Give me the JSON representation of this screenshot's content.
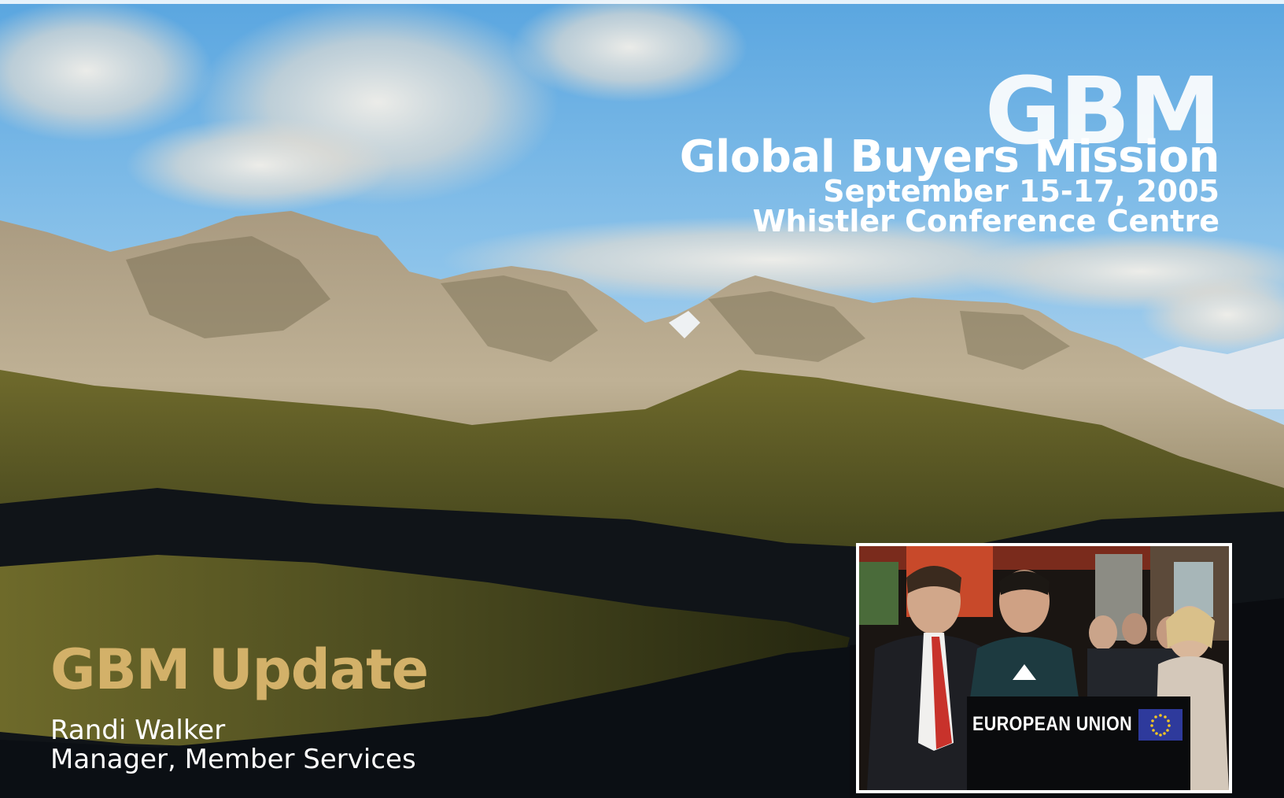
{
  "header": {
    "abbr": "GBM",
    "event_name": "Global Buyers Mission",
    "dates": "September 15-17, 2005",
    "venue": "Whistler Conference Centre"
  },
  "update": {
    "title": "GBM Update",
    "presenter_name": "Randi Walker",
    "presenter_role": "Manager, Member Services"
  },
  "photo": {
    "sign_text": "EUROPEAN UNION",
    "flag_icon": "eu-flag-icon"
  },
  "colors": {
    "accent_gold": "#d3b169",
    "title_white": "#ffffff",
    "sky": "#6fb2e6",
    "frame": "#ffffff"
  }
}
